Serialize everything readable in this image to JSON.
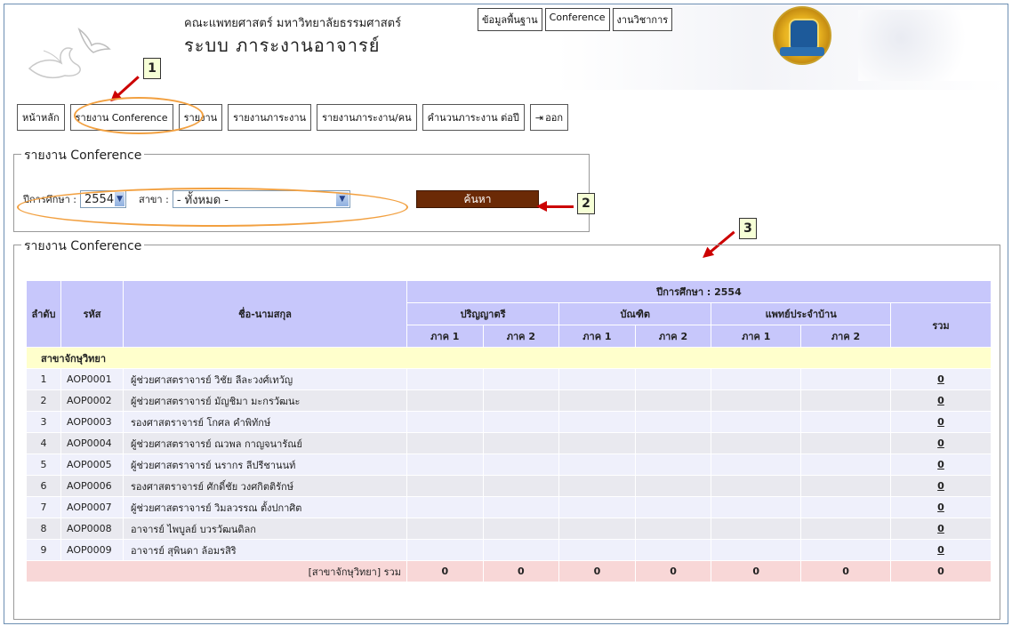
{
  "header": {
    "institution": "คณะแพทยศาสตร์ มหาวิทยาลัยธรรมศาสตร์",
    "system_title": "ระบบ ภาระงานอาจารย์",
    "top_nav": [
      "ข้อมูลพื้นฐาน",
      "Conference",
      "งานวิชาการ"
    ]
  },
  "main_nav": [
    "หน้าหลัก",
    "รายงาน Conference",
    "รายงาน",
    "รายงานภาระงาน",
    "รายงานภาระงาน/คน",
    "คำนวนภาระงาน ต่อปี",
    "ออก"
  ],
  "callouts": [
    "1",
    "2",
    "3"
  ],
  "search": {
    "legend": "รายงาน Conference",
    "year_label": "ปีการศึกษา :",
    "year_value": "2554",
    "branch_label": "สาขา :",
    "branch_value": "- ทั้งหมด -",
    "search_button": "ค้นหา"
  },
  "report": {
    "legend": "รายงาน Conference",
    "headers": {
      "order": "ลำดับ",
      "code": "รหัส",
      "name": "ชื่อ-นามสกุล",
      "year": "ปีการศึกษา : 2554",
      "bachelor": "ปริญญาตรี",
      "graduate": "บัณฑิต",
      "resident": "แพทย์ประจำบ้าน",
      "term1": "ภาค 1",
      "term2": "ภาค 2",
      "total": "รวม"
    },
    "group_name": "สาขาจักษุวิทยา",
    "rows": [
      {
        "no": "1",
        "code": "AOP0001",
        "name": "ผู้ช่วยศาสตราจารย์ วิชัย  ลีละวงศ์เทวัญ",
        "total": "0"
      },
      {
        "no": "2",
        "code": "AOP0002",
        "name": "ผู้ช่วยศาสตราจารย์ มัญชิมา  มะกรวัฒนะ",
        "total": "0"
      },
      {
        "no": "3",
        "code": "AOP0003",
        "name": "รองศาสตราจารย์ โกศล  คำพิทักษ์",
        "total": "0"
      },
      {
        "no": "4",
        "code": "AOP0004",
        "name": "ผู้ช่วยศาสตราจารย์ ณวพล  กาญจนารัณย์",
        "total": "0"
      },
      {
        "no": "5",
        "code": "AOP0005",
        "name": "ผู้ช่วยศาสตราจารย์ นรากร  ลีปรีชานนท์",
        "total": "0"
      },
      {
        "no": "6",
        "code": "AOP0006",
        "name": "รองศาสตราจารย์ ศักดิ์ชัย  วงศกิตติรักษ์",
        "total": "0"
      },
      {
        "no": "7",
        "code": "AOP0007",
        "name": "ผู้ช่วยศาสตราจารย์ วิมลวรรณ  ตั้งปกาศิต",
        "total": "0"
      },
      {
        "no": "8",
        "code": "AOP0008",
        "name": "อาจารย์ ไพบูลย์  บวรวัฒนดิลก",
        "total": "0"
      },
      {
        "no": "9",
        "code": "AOP0009",
        "name": "อาจารย์ สุพินดา  ล้อมรสิริ",
        "total": "0"
      }
    ],
    "total_row": {
      "label": "[สาขาจักษุวิทยา] รวม",
      "values": [
        "0",
        "0",
        "0",
        "0",
        "0",
        "0",
        "0"
      ]
    }
  }
}
